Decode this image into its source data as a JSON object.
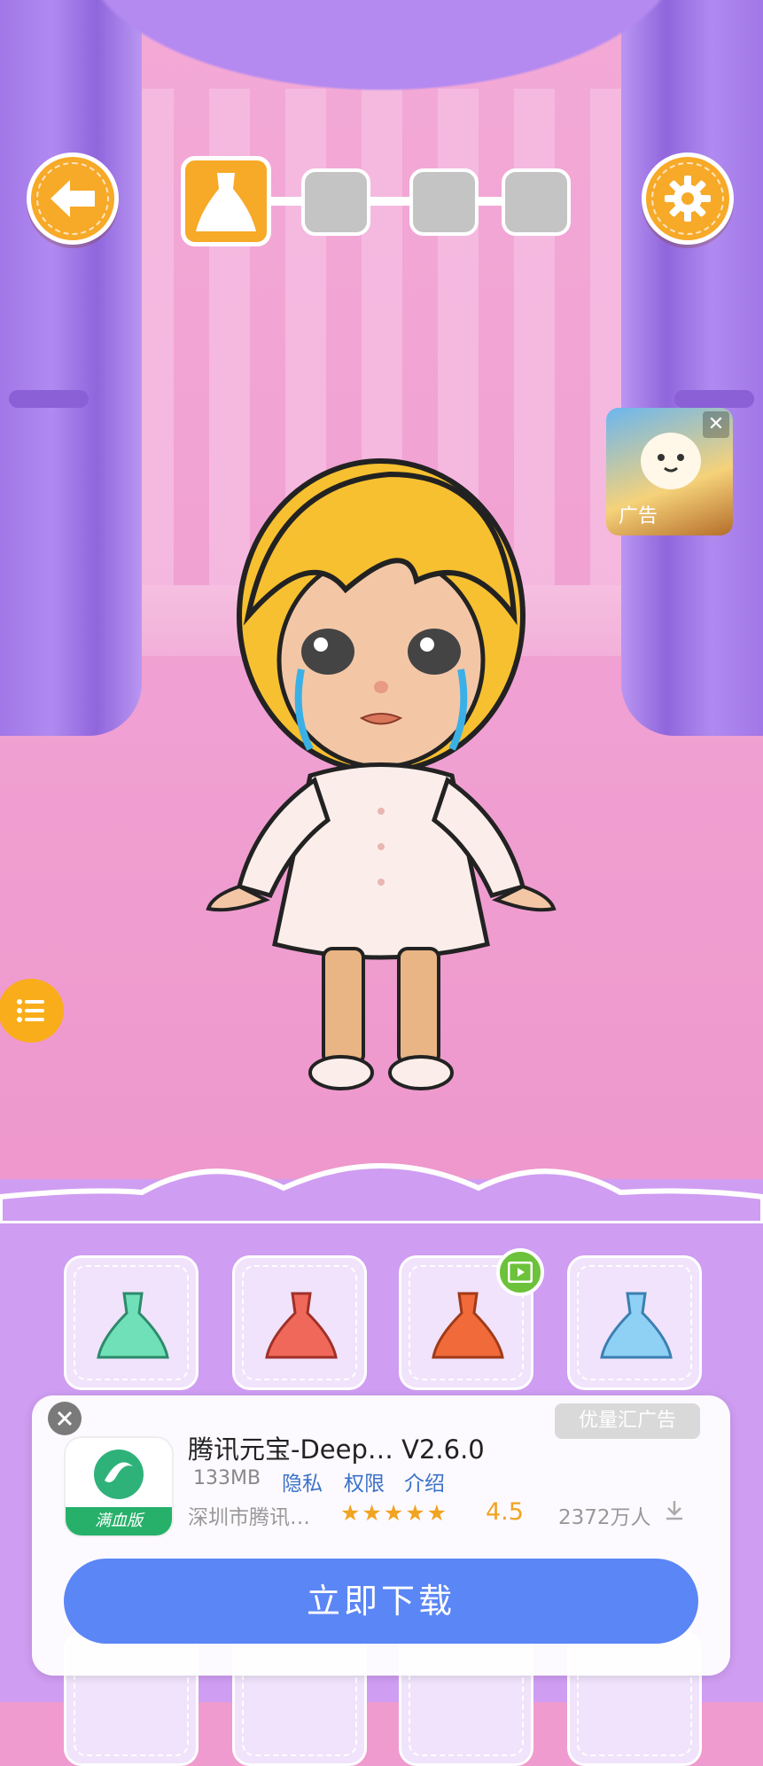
{
  "stage": {
    "colors": {
      "wall": "#f0a0d2",
      "curtain": "#a47ae8",
      "accent": "#f7a928"
    }
  },
  "header": {
    "back_icon": "arrow-left-icon",
    "settings_icon": "gear-icon",
    "steps": [
      {
        "icon": "dress-icon",
        "state": "active"
      },
      {
        "icon": "",
        "state": "locked"
      },
      {
        "icon": "",
        "state": "locked"
      },
      {
        "icon": "",
        "state": "locked"
      }
    ]
  },
  "floating_ad": {
    "label": "广告",
    "close": "✕"
  },
  "menu": {
    "icon": "list-icon"
  },
  "wardrobe": {
    "items": [
      {
        "name": "green-gown",
        "color": "#6fe0b8"
      },
      {
        "name": "pink-red-gown",
        "color": "#f0685a"
      },
      {
        "name": "orange-flame-gown",
        "color": "#f06a3a",
        "video_locked": true
      },
      {
        "name": "ice-blue-gown",
        "color": "#8fd0f5"
      }
    ]
  },
  "ad_card": {
    "source": "优量汇广告",
    "app_name": "腾讯元宝-Deep… V2.6.0",
    "size": "133MB",
    "links": [
      "隐私",
      "权限",
      "介绍"
    ],
    "developer": "深圳市腾讯…",
    "stars": "★★★★★",
    "rating": "4.5",
    "installs": "2372万人",
    "badge": "满血版",
    "button": "立即下载"
  }
}
